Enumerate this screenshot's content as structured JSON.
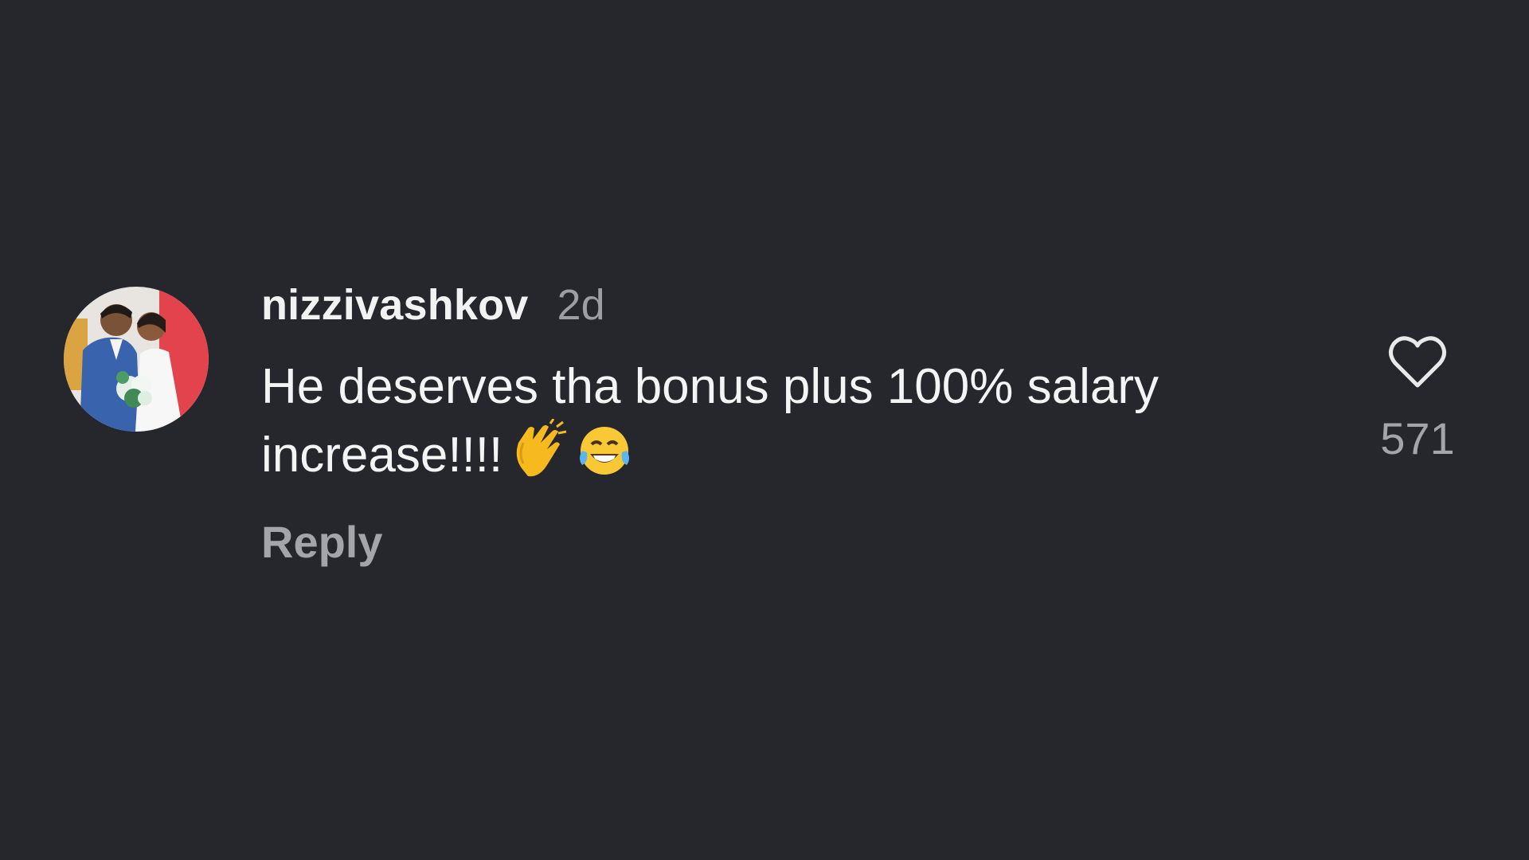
{
  "comment": {
    "username": "nizzivashkov",
    "timestamp": "2d",
    "text": "He deserves tha bonus plus 100% salary increase!!!!",
    "emojis": [
      "clapping-hands-icon",
      "tears-of-joy-icon"
    ],
    "reply_label": "Reply",
    "like_count": "571",
    "like_icon": "heart-outline-icon",
    "avatar_icon": "wedding-photo-avatar"
  },
  "colors": {
    "background": "#25272c",
    "primary_text": "#f2f2f2",
    "secondary_text": "#9c9ea3"
  }
}
